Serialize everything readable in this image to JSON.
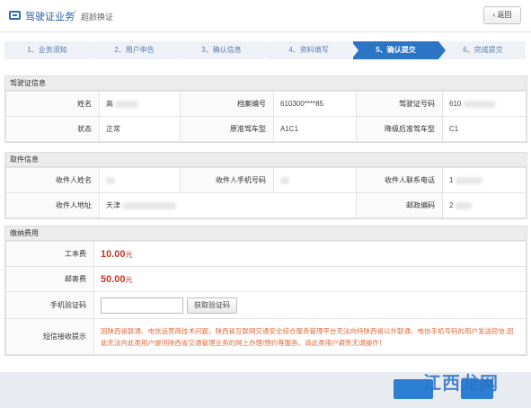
{
  "header": {
    "title": "驾驶证业务",
    "separator": "/",
    "subtitle": "超龄换证",
    "back_label": "‹ 返回"
  },
  "steps": [
    {
      "label": "1、业务须知",
      "active": false
    },
    {
      "label": "2、用户申告",
      "active": false
    },
    {
      "label": "3、确认信息",
      "active": false
    },
    {
      "label": "4、资料填写",
      "active": false
    },
    {
      "label": "5、确认提交",
      "active": true
    },
    {
      "label": "6、完成提交",
      "active": false
    }
  ],
  "license": {
    "title": "驾驶证信息",
    "name_label": "姓名",
    "name_value": "高",
    "file_no_label": "档案编号",
    "file_no_value": "610300****85",
    "license_no_label": "驾驶证号码",
    "license_no_value": "610",
    "status_label": "状态",
    "status_value": "正常",
    "orig_class_label": "原准驾车型",
    "orig_class_value": "A1C1",
    "down_class_label": "降级后准驾车型",
    "down_class_value": "C1"
  },
  "pickup": {
    "title": "取件信息",
    "recv_name_label": "收件人姓名",
    "recv_phone_label": "收件人手机号码",
    "recv_contact_label": "收件人联系电话",
    "recv_contact_value": "1",
    "recv_addr_label": "收件人地址",
    "recv_addr_value": "天津",
    "postcode_label": "邮政编码",
    "postcode_value": "2"
  },
  "fees": {
    "title": "缴纳费用",
    "cost_label": "工本费",
    "cost_value": "10.00",
    "postage_label": "邮寄费",
    "postage_value": "50.00",
    "unit": "元",
    "sms_label": "手机验证码",
    "sms_button": "获取验证码",
    "notice_label": "短信接收提示",
    "notice_text": "因陕西省联通、电信运营商技术问题，陕西省互联网交通安全综合服务管理平台无法向持陕西省以外联通、电信手机号码的用户发送短信,因此无法向此类用户提供陕西省交通管理业务的网上办理/预约等服务。请此类用户避免无谓操作！"
  },
  "watermark": "江西龙网",
  "colors": {
    "accent": "#2c74c4",
    "fee": "#c0392b",
    "notice": "#e06a3a"
  }
}
